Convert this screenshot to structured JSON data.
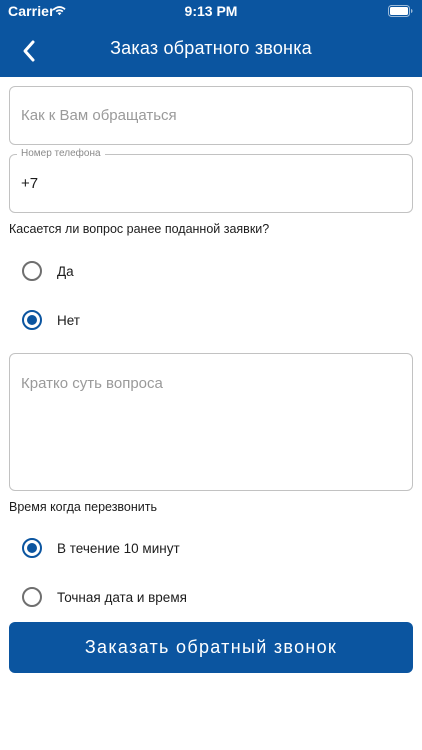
{
  "status_bar": {
    "carrier": "Carrier",
    "time": "9:13 PM",
    "wifi_icon": "wifi-icon",
    "battery_icon": "battery-icon"
  },
  "nav": {
    "back_icon": "chevron-left-icon",
    "title": "Заказ обратного звонка"
  },
  "form": {
    "name_field": {
      "placeholder": "Как к Вам обращаться",
      "value": ""
    },
    "phone_field": {
      "label": "Номер телефона",
      "value": "+7"
    },
    "related_question": {
      "label": "Касается ли вопрос ранее поданной заявки?",
      "options": [
        {
          "label": "Да",
          "checked": false
        },
        {
          "label": "Нет",
          "checked": true
        }
      ]
    },
    "question_field": {
      "placeholder": "Кратко суть вопроса",
      "value": ""
    },
    "callback_time": {
      "label": "Время когда перезвонить",
      "options": [
        {
          "label": "В течение 10 минут",
          "checked": true
        },
        {
          "label": "Точная дата и время",
          "checked": false
        }
      ]
    },
    "submit_label": "Заказать обратный звонок"
  },
  "colors": {
    "brand": "#0b55a0",
    "border": "#c2c2c2",
    "placeholder": "#9a9a9a",
    "background": "#ffffff"
  }
}
